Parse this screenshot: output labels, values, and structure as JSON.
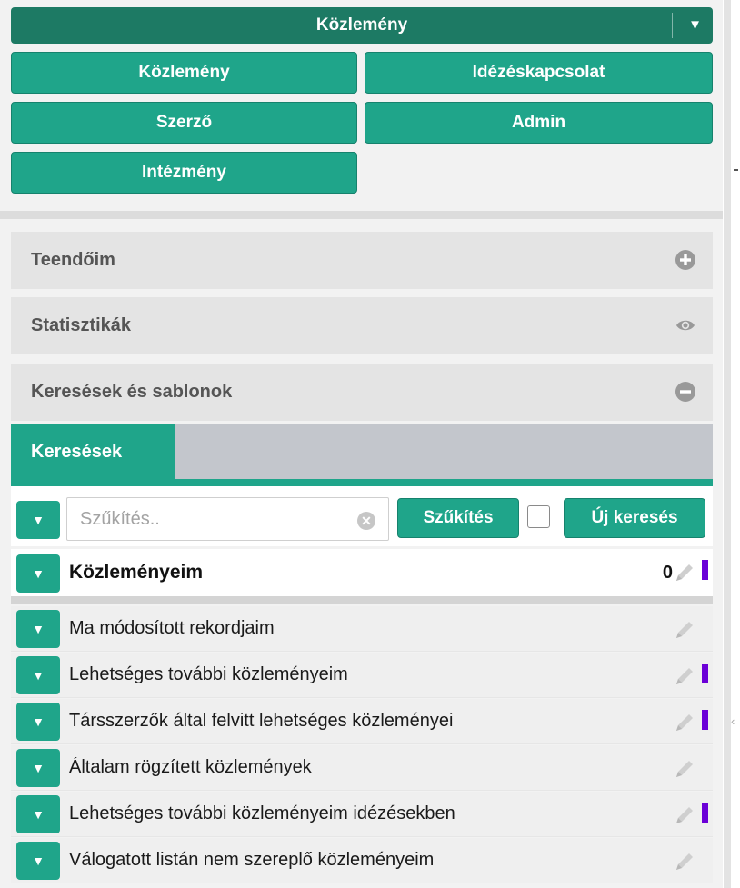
{
  "menu": {
    "main_label": "Közlemény",
    "buttons": [
      {
        "label": "Közlemény"
      },
      {
        "label": "Idézéskapcsolat"
      },
      {
        "label": "Szerző"
      },
      {
        "label": "Admin"
      },
      {
        "label": "Intézmény"
      }
    ]
  },
  "accordion": [
    {
      "label": "Teendőim",
      "icon": "plus-circle-icon"
    },
    {
      "label": "Statisztikák",
      "icon": "eye-icon"
    },
    {
      "label": "Keresések és sablonok",
      "icon": "minus-circle-icon"
    }
  ],
  "tabs": {
    "active_label": "Keresések"
  },
  "search": {
    "placeholder": "Szűkítés..",
    "filter_button": "Szűkítés",
    "new_search_button": "Új keresés"
  },
  "list_header": {
    "label": "Közleményeim",
    "count": "0",
    "marked": true
  },
  "list_items": [
    {
      "label": "Ma módosított rekordjaim",
      "marked": false
    },
    {
      "label": "Lehetséges további közleményeim",
      "marked": true
    },
    {
      "label": "Társszerzők által felvitt lehetséges közleményei",
      "marked": true
    },
    {
      "label": "Általam rögzített közlemények",
      "marked": false
    },
    {
      "label": "Lehetséges további közleményeim idézésekben",
      "marked": true
    },
    {
      "label": "Válogatott listán nem szereplő közleményeim",
      "marked": false
    }
  ],
  "colors": {
    "primary": "#1fa58a",
    "primary_dark": "#1d7a64",
    "marker": "#6b00d7"
  }
}
